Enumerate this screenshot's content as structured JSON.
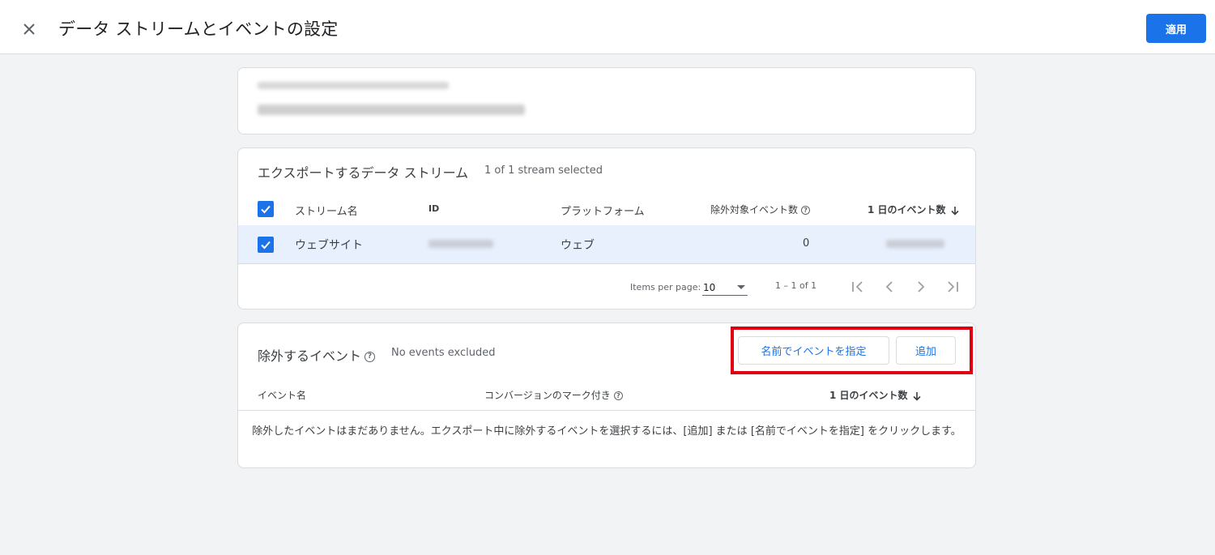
{
  "header": {
    "title": "データ ストリームとイベントの設定",
    "apply_label": "適用"
  },
  "streams": {
    "title": "エクスポートするデータ ストリーム",
    "selection_status": "1 of 1 stream selected",
    "columns": {
      "name": "ストリーム名",
      "id": "ID",
      "platform": "プラットフォーム",
      "excluded_events": "除外対象イベント数",
      "daily_events": "1 日のイベント数"
    },
    "rows": [
      {
        "name": "ウェブサイト",
        "platform": "ウェブ",
        "excluded_events": "0"
      }
    ],
    "pager": {
      "items_per_page_label": "Items per page:",
      "items_per_page_value": "10",
      "range": "1 – 1 of 1"
    }
  },
  "excluded_events": {
    "title": "除外するイベント",
    "status": "No events excluded",
    "specify_by_name_label": "名前でイベントを指定",
    "add_label": "追加",
    "columns": {
      "event_name": "イベント名",
      "conversion": "コンバージョンのマーク付き",
      "daily_events": "1 日のイベント数"
    },
    "empty_message": "除外したイベントはまだありません。エクスポート中に除外するイベントを選択するには、[追加] または [名前でイベントを指定] をクリックします。"
  },
  "colors": {
    "accent": "#1a73e8",
    "selected_row": "#e8f0fe",
    "highlight": "#e0000f"
  }
}
